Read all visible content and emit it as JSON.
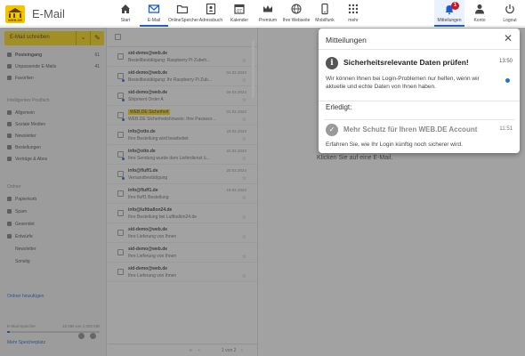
{
  "app": {
    "logo_text": "WEB.DE",
    "title": "E-Mail"
  },
  "nav": {
    "items": [
      {
        "label": "Start",
        "icon": "home-icon"
      },
      {
        "label": "E-Mail",
        "icon": "mail-icon"
      },
      {
        "label": "OnlineSpeicher",
        "icon": "folder-icon"
      },
      {
        "label": "Adressbuch",
        "icon": "contacts-icon"
      },
      {
        "label": "Kalender",
        "icon": "calendar-icon"
      },
      {
        "label": "Premium",
        "icon": "crown-icon"
      },
      {
        "label": "Ihre Webseite",
        "icon": "globe-icon"
      },
      {
        "label": "Mobilfunk",
        "icon": "phone-icon"
      },
      {
        "label": "mehr",
        "icon": "grid-icon"
      }
    ],
    "right": [
      {
        "label": "Mitteilungen",
        "icon": "bell-icon",
        "badge": "1"
      },
      {
        "label": "Konto",
        "icon": "user-icon"
      },
      {
        "label": "Logout",
        "icon": "power-icon"
      }
    ]
  },
  "sidebar": {
    "compose_label": "E-Mail schreiben",
    "folders": [
      {
        "label": "Posteingang",
        "count": "61"
      },
      {
        "label": "Unpassende E-Mails",
        "count": "41"
      },
      {
        "label": "Favoriten",
        "count": ""
      }
    ],
    "section1": "Intelligentes Postfach",
    "smart": [
      {
        "label": "Allgemein",
        "count": ""
      },
      {
        "label": "Soziale Medien",
        "count": ""
      },
      {
        "label": "Newsletter",
        "count": ""
      },
      {
        "label": "Bestellungen",
        "count": ""
      },
      {
        "label": "Verträge & Abos",
        "count": ""
      }
    ],
    "section2": "Ordner",
    "ordner": [
      {
        "label": "Papierkorb"
      },
      {
        "label": "Spam"
      },
      {
        "label": "Gesendet"
      },
      {
        "label": "Entwürfe"
      },
      {
        "label": "Newsletter"
      },
      {
        "label": "Sonstig"
      }
    ],
    "add_folder": "Ordner hinzufügen",
    "storage_label": "E-Mail-Speicher",
    "storage_value": "33 MB von 1.000 MB",
    "storage_fraction": 0.03,
    "more_storage": "Mehr Speicherplatz"
  },
  "mails": [
    {
      "sender": "sid-demo@web.de",
      "subject": "Bestellbestätigung: Raspberry Pi Zubeh...",
      "date": "",
      "unread": false,
      "tag": ""
    },
    {
      "sender": "sid-demo@web.de",
      "subject": "Bestellbestätigung: Ihr Raspberry Pi Zub...",
      "date": "04.02.2024",
      "unread": true,
      "tag": ""
    },
    {
      "sender": "sid-demo@web.de",
      "subject": "Shipment Order A",
      "date": "04.02.2024",
      "unread": true,
      "tag": ""
    },
    {
      "sender": "WEB.DE Sicherheit",
      "subject": "WEB.DE Sicherheitshinweis: Ihre Passwor...",
      "date": "01.02.2024",
      "unread": true,
      "tag": "WEB.DE Sicherheit"
    },
    {
      "sender": "info@otto.de",
      "subject": "Ihre Bestellung wird bearbeitet",
      "date": "23.02.2024",
      "unread": false,
      "tag": ""
    },
    {
      "sender": "info@otto.de",
      "subject": "Ihre Sendung wurde dem Lieferdienst ü...",
      "date": "22.02.2024",
      "unread": true,
      "tag": ""
    },
    {
      "sender": "info@fluff1.de",
      "subject": "Versandbestätigung",
      "date": "20.02.2024",
      "unread": true,
      "tag": ""
    },
    {
      "sender": "info@fluff1.de",
      "subject": "Ihre fluff1 Bestellung",
      "date": "19.02.2024",
      "unread": false,
      "tag": ""
    },
    {
      "sender": "info@luftballon24.de",
      "subject": "Ihre Bestellung bei Luftballon24.de",
      "date": "",
      "unread": false,
      "tag": ""
    },
    {
      "sender": "sid-demo@web.de",
      "subject": "Ihre Lieferung von Ihnen",
      "date": "",
      "unread": false,
      "tag": ""
    },
    {
      "sender": "sid-demo@web.de",
      "subject": "Ihre Lieferung von Ihnen",
      "date": "",
      "unread": false,
      "tag": ""
    },
    {
      "sender": "sid-demo@web.de",
      "subject": "Ihre Lieferung von Ihnen",
      "date": "",
      "unread": false,
      "tag": ""
    }
  ],
  "pager": {
    "label": "1 von 2"
  },
  "reader": {
    "text": "Klicken Sie auf eine E-Mail."
  },
  "panel": {
    "title": "Mitteilungen",
    "notification1": {
      "title": "Sicherheitsrelevante Daten prüfen!",
      "time": "13:50",
      "body": "Wir können Ihnen bei Login-Problemen nur helfen, wenn wir aktuelle und echte Daten von Ihnen haben.",
      "icon": "info-icon"
    },
    "done_label": "Erledigt:",
    "notification2": {
      "title": "Mehr Schutz für Ihren WEB.DE Account",
      "time": "11:51",
      "body": "Erfahren Sie, wie Ihr Login künftig noch sicherer wird.",
      "icon": "check-icon"
    }
  },
  "colors": {
    "accent": "#1c5bd3",
    "brand_yellow": "#ffd800",
    "badge_red": "#d0161e"
  }
}
